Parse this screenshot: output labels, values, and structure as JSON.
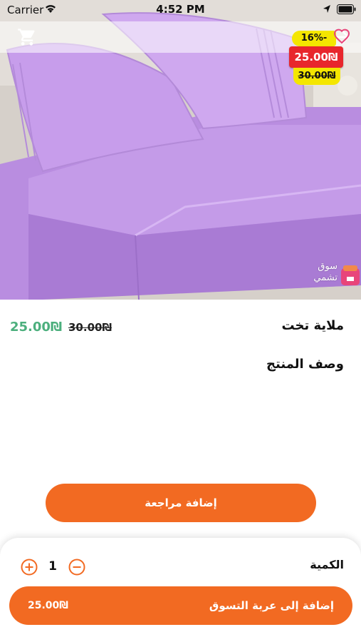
{
  "status_bar": {
    "carrier": "Carrier",
    "time": "4:52 PM"
  },
  "hero": {
    "discount_badge": "16%-",
    "sale_price": "25.00₪",
    "original_price": "30.00₪",
    "watermark_text": "سوق تشمي"
  },
  "product": {
    "title": "ملاية تخت",
    "price": "25.00₪",
    "original_price": "30.00₪",
    "description_heading": "وصف المنتج"
  },
  "actions": {
    "add_review_label": "إضافة مراجعة"
  },
  "bottom_sheet": {
    "quantity_label": "الكمية",
    "quantity_value": "1",
    "add_to_cart_label": "إضافة إلى عربة التسوق",
    "add_to_cart_price": "25.00₪"
  },
  "colors": {
    "accent": "#f26a22",
    "price_green": "#4caf7d",
    "sale_red": "#e8262c",
    "badge_yellow": "#f4e600"
  }
}
